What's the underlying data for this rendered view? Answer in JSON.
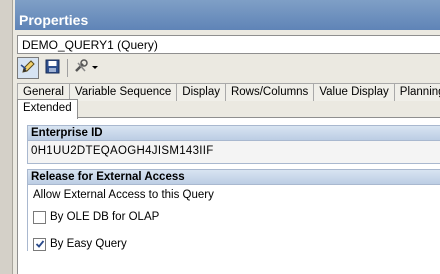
{
  "panel": {
    "title": "Properties"
  },
  "object": {
    "name": "DEMO_QUERY1 (Query)"
  },
  "toolbar": {
    "buttons": [
      {
        "icon": "edit-pencil-icon",
        "state": "active"
      },
      {
        "icon": "save-disk-icon"
      },
      {
        "icon": "tools-dropdown-icon"
      }
    ]
  },
  "tabs": {
    "row1": [
      "General",
      "Variable Sequence",
      "Display",
      "Rows/Columns",
      "Value Display",
      "Planning"
    ],
    "row2": [
      "Extended"
    ],
    "selected": "Extended"
  },
  "enterprise": {
    "heading": "Enterprise ID",
    "value": "0H1UU2DTEQAOGH4JISM143IIF"
  },
  "release": {
    "heading": "Release for External Access",
    "caption": "Allow External Access to this Query",
    "options": [
      {
        "label": "By OLE DB for OLAP",
        "checked": false
      },
      {
        "label": "By Easy Query",
        "checked": true
      }
    ]
  },
  "colors": {
    "title_bar": "#6b8fc0",
    "group_header": "#c8d7ea",
    "check": "#2a4a8a"
  }
}
